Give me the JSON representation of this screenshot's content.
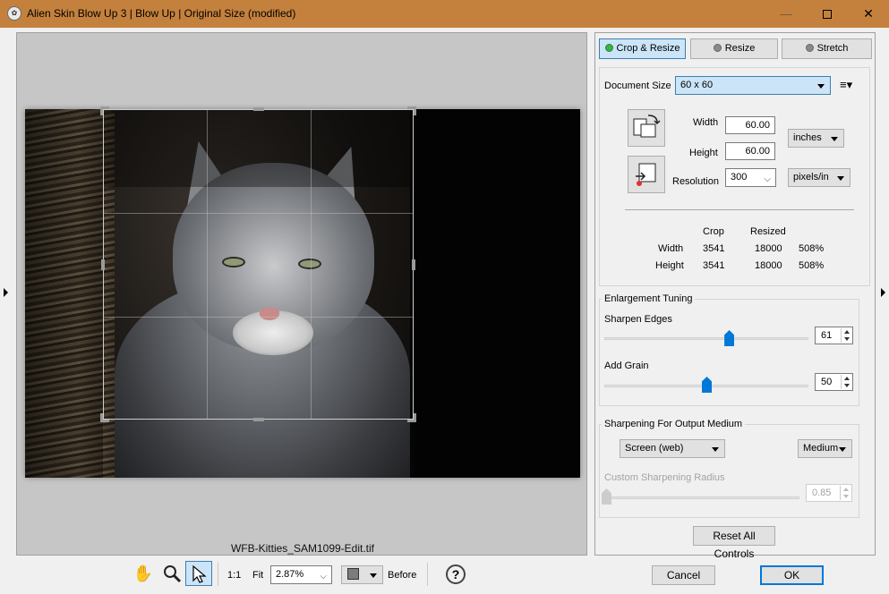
{
  "window": {
    "title": "Alien Skin Blow Up 3 | Blow Up | Original Size (modified)",
    "app_icon": "aspen-logo-icon"
  },
  "preview": {
    "filename": "WFB-Kitties_SAM1099-Edit.tif"
  },
  "tabs": [
    {
      "label": "Crop & Resize",
      "active": true
    },
    {
      "label": "Resize",
      "active": false
    },
    {
      "label": "Stretch",
      "active": false
    }
  ],
  "document": {
    "size_label": "Document Size",
    "size_value": "60 x 60",
    "width_label": "Width",
    "width_value": "60.00",
    "height_label": "Height",
    "height_value": "60.00",
    "unit_value": "inches",
    "resolution_label": "Resolution",
    "resolution_value": "300",
    "resolution_unit": "pixels/in"
  },
  "stats": {
    "headers": [
      "Crop",
      "Resized"
    ],
    "rows": [
      {
        "label": "Width",
        "crop": "3541",
        "resized": "18000",
        "percent": "508%"
      },
      {
        "label": "Height",
        "crop": "3541",
        "resized": "18000",
        "percent": "508%"
      }
    ]
  },
  "enlargement": {
    "title": "Enlargement Tuning",
    "sharpen_label": "Sharpen Edges",
    "sharpen_value": "61",
    "sharpen_fraction": 0.61,
    "grain_label": "Add Grain",
    "grain_value": "50",
    "grain_fraction": 0.5
  },
  "sharpening": {
    "title": "Sharpening For Output Medium",
    "medium_value": "Screen (web)",
    "strength_value": "Medium",
    "radius_label": "Custom Sharpening Radius",
    "radius_value": "0.85",
    "radius_fraction": 0.0
  },
  "buttons": {
    "reset": "Reset All Controls",
    "cancel": "Cancel",
    "ok": "OK"
  },
  "toolbar": {
    "one_to_one": "1:1",
    "fit": "Fit",
    "zoom_value": "2.87%",
    "before": "Before",
    "help": "?"
  },
  "colors": {
    "titlebar": "#c4813d",
    "accent": "#0078d7",
    "active_tab": "#cce4f7"
  }
}
